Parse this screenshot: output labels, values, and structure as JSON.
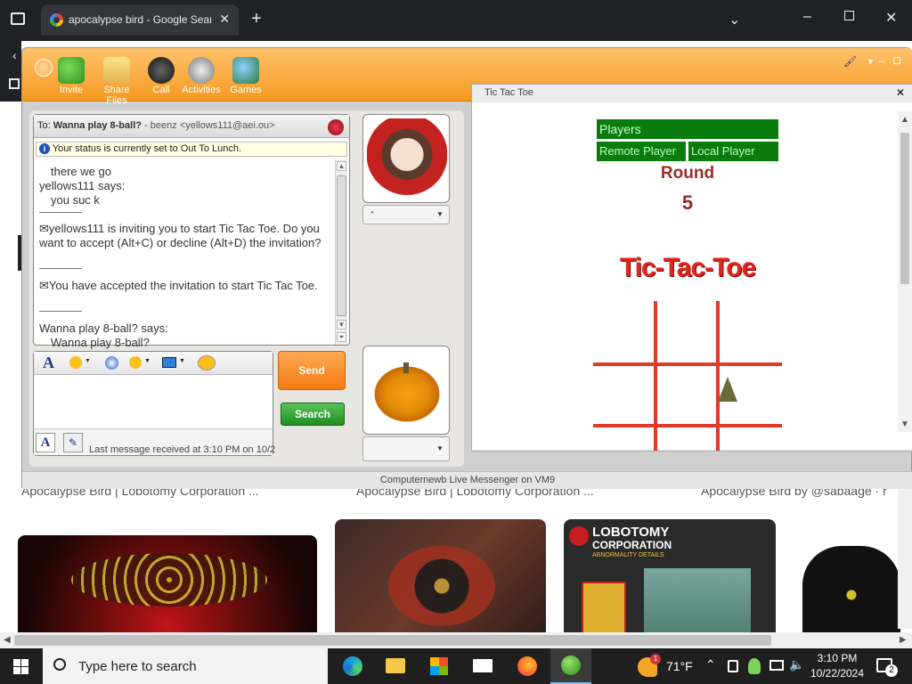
{
  "browser": {
    "tab_title": "apocalypse bird - Google Search",
    "tab_close": "✕",
    "new_tab": "+",
    "captions": [
      "Apocalypse Bird | Lobotomy Corporation ...",
      "Apocalypse Bird | Lobotomy Corporation ...",
      "Apocalypse Bird by @sabaage · r"
    ],
    "thumb_text": {
      "title": "LOBOTOMY",
      "sub": "CORPORATION",
      "detail": "ABNORMALITY DETAILS"
    }
  },
  "messenger": {
    "toolbar": [
      "Invite",
      "Share Files",
      "Call",
      "Activities",
      "Games"
    ],
    "to_label": "To:",
    "to_name": "Wanna play 8-ball?",
    "to_addr": "- beenz <yellows111@aei.ou>",
    "status_notice": "Your status is currently set to Out To Lunch.",
    "messages": {
      "m1": "there we go",
      "m2_sender": "yellows111 says:",
      "m2_text": "you suc k",
      "m3": "yellows111 is inviting you to start Tic Tac Toe. Do you want to accept (Alt+C) or decline (Alt+D) the invitation?",
      "m4": "You have accepted the invitation to start Tic Tac Toe.",
      "m5_sender": "Wanna play 8-ball? says:",
      "m5_text": "Wanna play 8-ball?"
    },
    "send_label": "Send",
    "search_label": "Search",
    "last_message": "Last message received at 3:10 PM on 10/2",
    "footer": "Computernewb Live Messenger on VM9"
  },
  "game": {
    "window_title": "Tic Tac Toe",
    "close": "✕",
    "players_header": "Players",
    "remote_player": "Remote Player",
    "local_player": "Local Player",
    "round_label": "Round",
    "round_number": "5",
    "logo_text": "Tic-Tac-Toe"
  },
  "taskbar": {
    "search_placeholder": "Type here to search",
    "weather": "71°F",
    "weather_badge": "1",
    "time": "3:10 PM",
    "date": "10/22/2024",
    "notifications": "2"
  }
}
